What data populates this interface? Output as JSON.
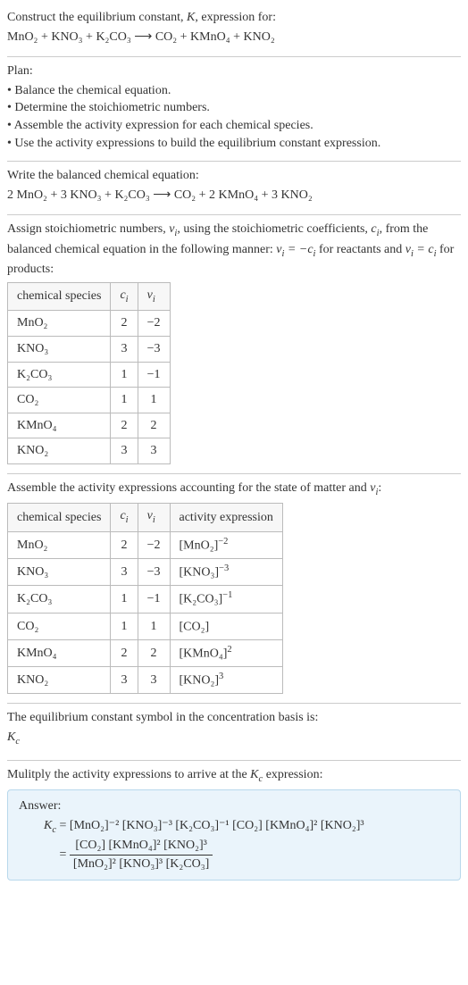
{
  "header": {
    "line1_prefix": "Construct the equilibrium constant, ",
    "line1_K": "K",
    "line1_suffix": ", expression for:",
    "equation": "MnO₂ + KNO₃ + K₂CO₃  ⟶  CO₂ + KMnO₄ + KNO₂"
  },
  "plan": {
    "title": "Plan:",
    "items": [
      "Balance the chemical equation.",
      "Determine the stoichiometric numbers.",
      "Assemble the activity expression for each chemical species.",
      "Use the activity expressions to build the equilibrium constant expression."
    ]
  },
  "balanced": {
    "title": "Write the balanced chemical equation:",
    "equation": "2 MnO₂ + 3 KNO₃ + K₂CO₃  ⟶  CO₂ + 2 KMnO₄ + 3 KNO₂"
  },
  "stoich": {
    "intro_a": "Assign stoichiometric numbers, ",
    "intro_b": ", using the stoichiometric coefficients, ",
    "intro_c": ", from the balanced chemical equation in the following manner: ",
    "intro_d": " for reactants and ",
    "intro_e": " for products:",
    "nu": "ν",
    "c": "c",
    "i": "i",
    "eq1": " = −",
    "eq2": " = ",
    "headers": [
      "chemical species",
      "cᵢ",
      "νᵢ"
    ],
    "rows": [
      {
        "species": "MnO₂",
        "c": "2",
        "nu": "−2"
      },
      {
        "species": "KNO₃",
        "c": "3",
        "nu": "−3"
      },
      {
        "species": "K₂CO₃",
        "c": "1",
        "nu": "−1"
      },
      {
        "species": "CO₂",
        "c": "1",
        "nu": "1"
      },
      {
        "species": "KMnO₄",
        "c": "2",
        "nu": "2"
      },
      {
        "species": "KNO₂",
        "c": "3",
        "nu": "3"
      }
    ]
  },
  "activity": {
    "intro_a": "Assemble the activity expressions accounting for the state of matter and ",
    "intro_b": ":",
    "headers": [
      "chemical species",
      "cᵢ",
      "νᵢ",
      "activity expression"
    ],
    "rows": [
      {
        "species": "MnO₂",
        "c": "2",
        "nu": "−2",
        "base": "[MnO₂]",
        "exp": "−2"
      },
      {
        "species": "KNO₃",
        "c": "3",
        "nu": "−3",
        "base": "[KNO₃]",
        "exp": "−3"
      },
      {
        "species": "K₂CO₃",
        "c": "1",
        "nu": "−1",
        "base": "[K₂CO₃]",
        "exp": "−1"
      },
      {
        "species": "CO₂",
        "c": "1",
        "nu": "1",
        "base": "[CO₂]",
        "exp": ""
      },
      {
        "species": "KMnO₄",
        "c": "2",
        "nu": "2",
        "base": "[KMnO₄]",
        "exp": "2"
      },
      {
        "species": "KNO₂",
        "c": "3",
        "nu": "3",
        "base": "[KNO₂]",
        "exp": "3"
      }
    ]
  },
  "symbol": {
    "line": "The equilibrium constant symbol in the concentration basis is:",
    "K": "K",
    "c": "c"
  },
  "multiply": {
    "line_a": "Mulitply the activity expressions to arrive at the ",
    "line_b": " expression:"
  },
  "answer": {
    "label": "Answer:",
    "lhs_K": "K",
    "lhs_c": "c",
    "eq": " = ",
    "rhs_flat": "[MnO₂]⁻² [KNO₃]⁻³ [K₂CO₃]⁻¹ [CO₂] [KMnO₄]² [KNO₂]³",
    "eq2": " = ",
    "num": "[CO₂] [KMnO₄]² [KNO₂]³",
    "den": "[MnO₂]² [KNO₃]³ [K₂CO₃]"
  }
}
